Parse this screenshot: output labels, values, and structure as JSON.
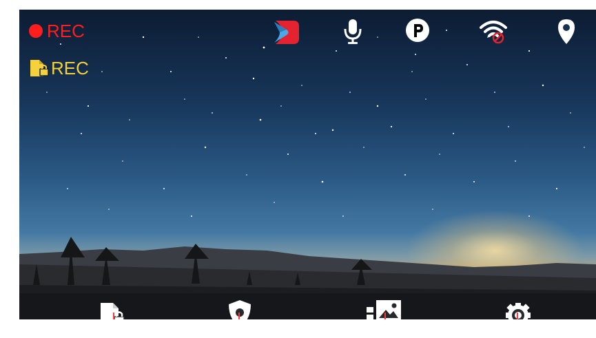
{
  "status": {
    "recording_label": "REC",
    "event_recording_label": "REC"
  },
  "status_icons": [
    "app-logo-icon",
    "microphone-icon",
    "parking-mode-icon",
    "wifi-disabled-icon",
    "gps-location-icon"
  ],
  "bottom_bar": {
    "buttons": [
      "locked-file-icon",
      "privacy-shield-icon",
      "gallery-icon",
      "settings-icon"
    ]
  },
  "colors": {
    "recording_red": "#ff1e1e",
    "event_yellow": "#f5d23c",
    "icon_white": "#ffffff",
    "logo_blue": "#4aa9e6",
    "logo_red": "#e3232f",
    "pointer_red": "#ff3a3a"
  }
}
